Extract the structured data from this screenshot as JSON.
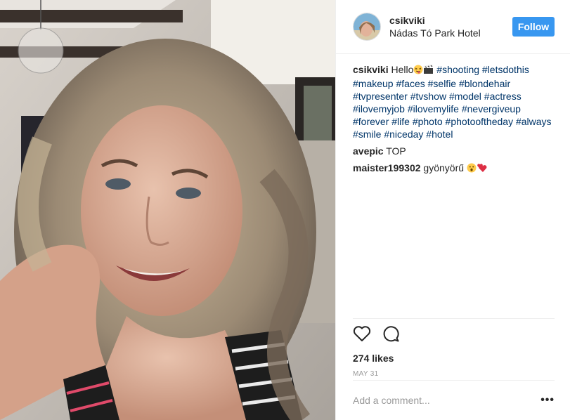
{
  "post": {
    "username": "csikviki",
    "location": "Nádas Tó Park Hotel",
    "follow_label": "Follow",
    "caption": {
      "user": "csikviki",
      "text_prefix": "Hello",
      "emojis": [
        "squinting-face-with-tongue",
        "clapper-board"
      ],
      "hashtags": [
        "#shooting",
        "#letsdothis",
        "#makeup",
        "#faces",
        "#selfie",
        "#blondehair",
        "#tvpresenter",
        "#tvshow",
        "#model",
        "#actress",
        "#ilovemyjob",
        "#ilovemylife",
        "#nevergiveup",
        "#forever",
        "#life",
        "#photo",
        "#photooftheday",
        "#always",
        "#smile",
        "#niceday",
        "#hotel"
      ]
    },
    "comments": [
      {
        "user": "avepic",
        "text": "TOP"
      },
      {
        "user": "maister199302",
        "text": "gyönyörű",
        "emojis": [
          "astonished-face",
          "two-hearts"
        ]
      }
    ],
    "likes": "274 likes",
    "date": "MAY 31",
    "add_comment_placeholder": "Add a comment...",
    "more_label": "•••",
    "icons": {
      "like": "heart-icon",
      "comment": "comment-bubble-icon",
      "options": "more-options-icon"
    },
    "colors": {
      "follow_button": "#3897f0",
      "hashtag": "#003569",
      "date": "#999999"
    }
  }
}
